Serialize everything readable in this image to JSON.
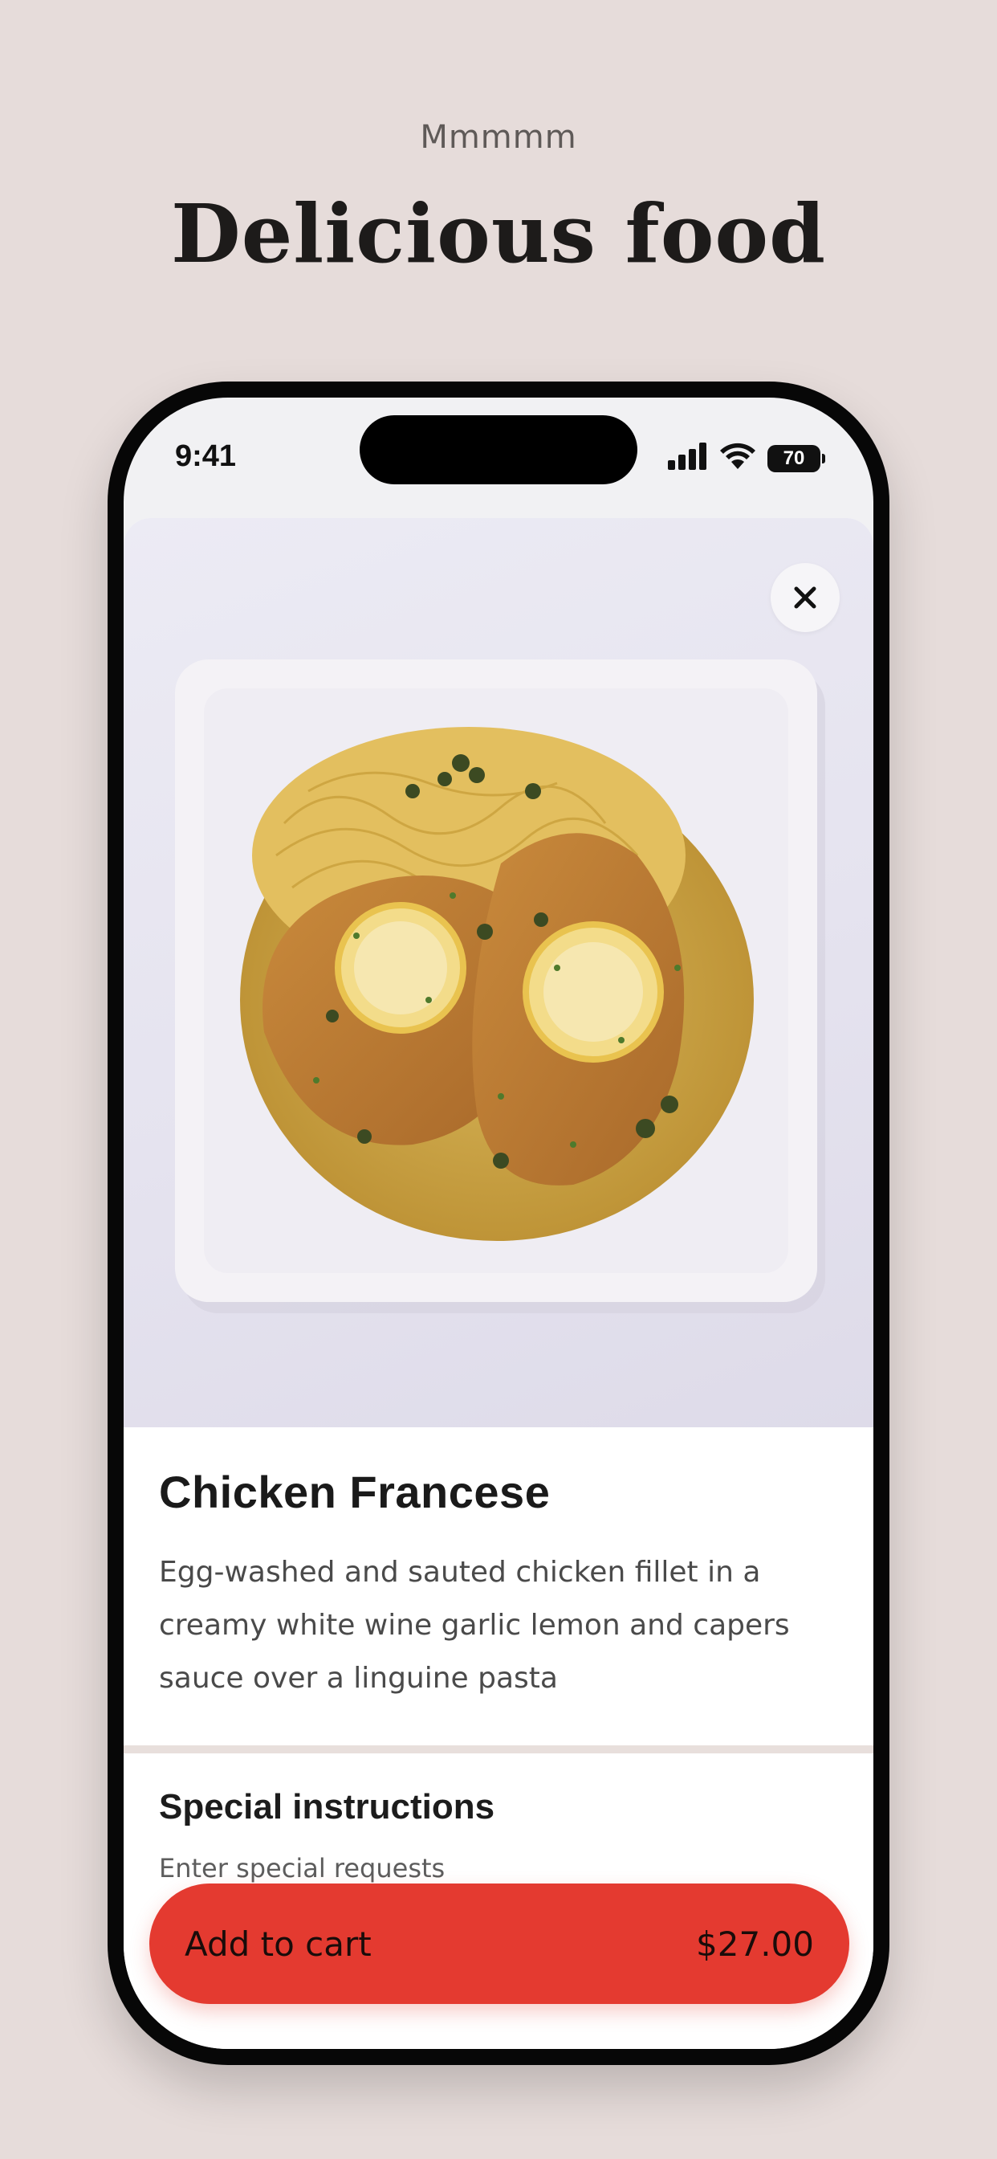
{
  "promo": {
    "eyebrow": "Mmmmm",
    "headline": "Delicious food"
  },
  "status_bar": {
    "time": "9:41",
    "battery": "70",
    "icons": [
      "signal-icon",
      "wifi-icon",
      "battery-icon"
    ]
  },
  "dish": {
    "name": "Chicken Francese",
    "description": "Egg-washed and sauted chicken fillet in a creamy white wine garlic lemon and capers sauce over a linguine pasta",
    "image": "chicken-francese-photo"
  },
  "special_instructions": {
    "title": "Special instructions",
    "placeholder": "Enter special requests"
  },
  "cart": {
    "label": "Add to cart",
    "price": "$27.00"
  },
  "colors": {
    "background": "#e6dcda",
    "cta": "#e43a30"
  }
}
